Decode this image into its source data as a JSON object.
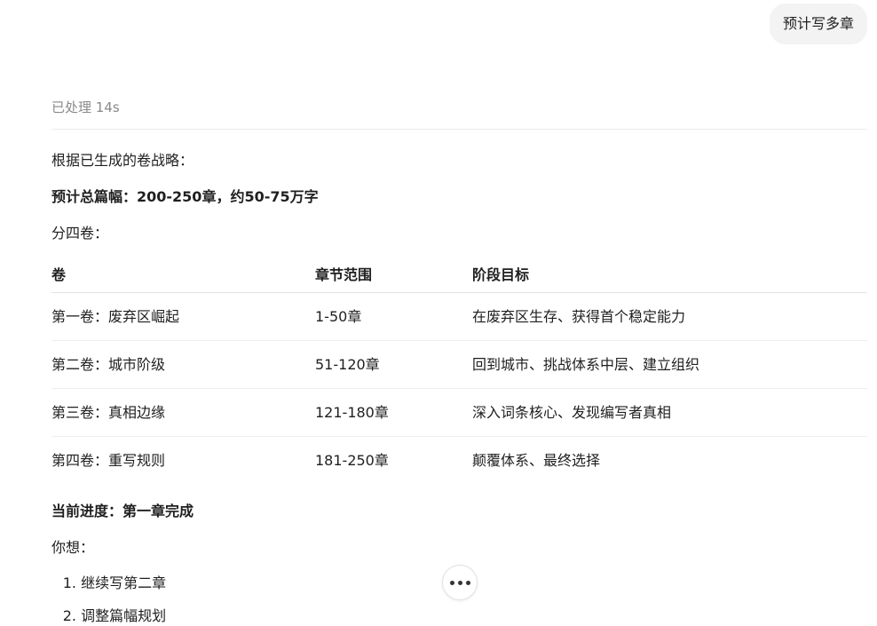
{
  "user_message": "预计写多章",
  "status": "已处理 14s",
  "intro": "根据已生成的卷战略：",
  "total_length": "预计总篇幅：200-250章，约50-75万字",
  "volumes_intro": "分四卷：",
  "table": {
    "headers": [
      "卷",
      "章节范围",
      "阶段目标"
    ],
    "rows": [
      [
        "第一卷：废弃区崛起",
        "1-50章",
        "在废弃区生存、获得首个稳定能力"
      ],
      [
        "第二卷：城市阶级",
        "51-120章",
        "回到城市、挑战体系中层、建立组织"
      ],
      [
        "第三卷：真相边缘",
        "121-180章",
        "深入词条核心、发现编写者真相"
      ],
      [
        "第四卷：重写规则",
        "181-250章",
        "颠覆体系、最终选择"
      ]
    ]
  },
  "progress": "当前进度：第一章完成",
  "question": "你想：",
  "options": [
    {
      "num": "1.",
      "label": "继续写第二章"
    },
    {
      "num": "2.",
      "label": "调整篇幅规划"
    }
  ],
  "icons": {
    "more": "more-horizontal-icon"
  }
}
